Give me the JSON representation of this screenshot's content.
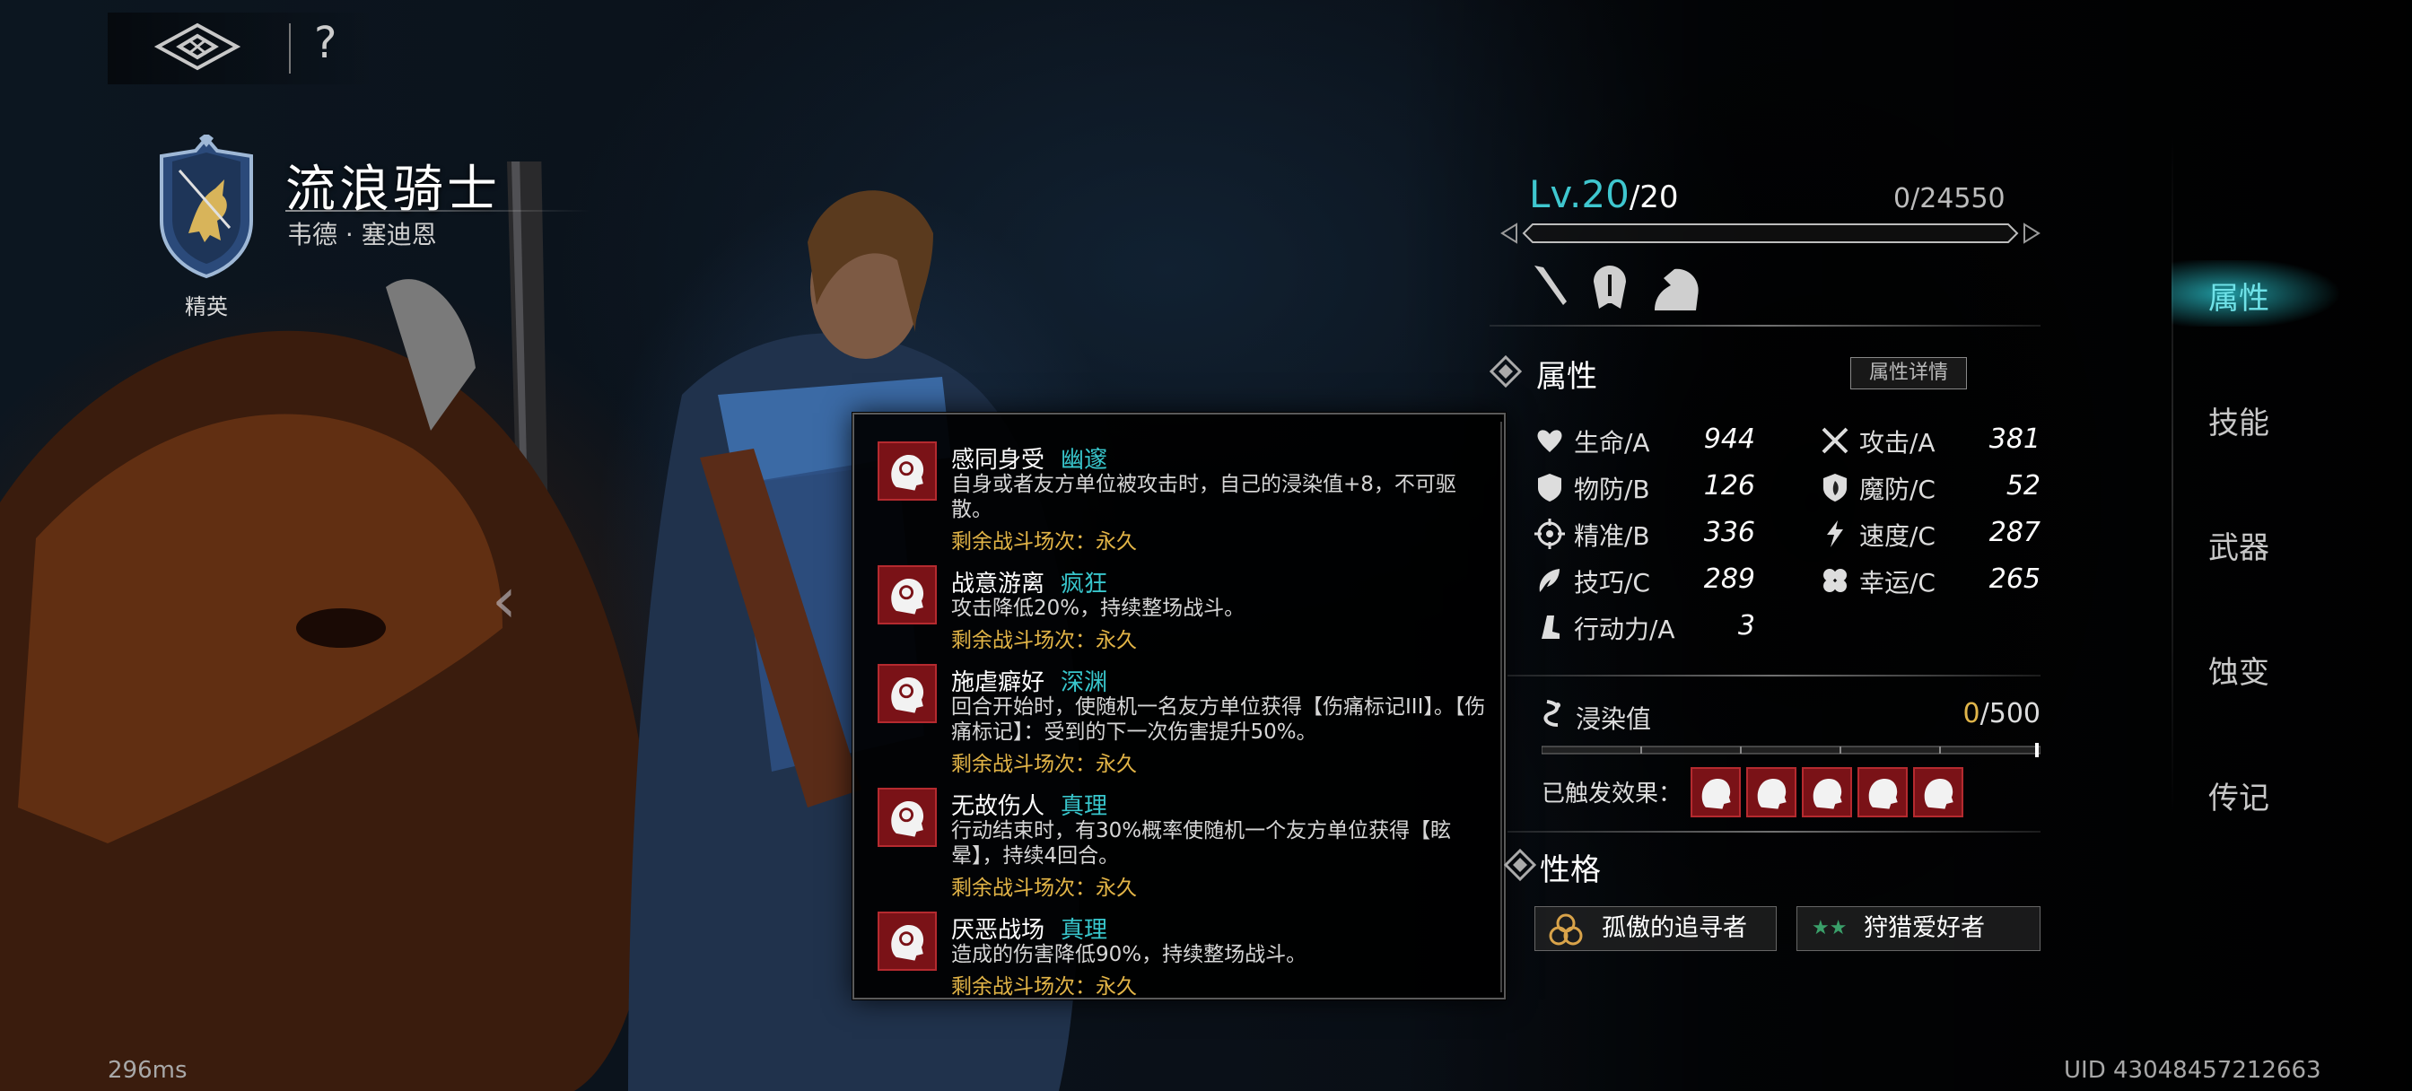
{
  "topbar": {
    "help": "?"
  },
  "hero": {
    "name": "流浪骑士",
    "subtitle": "韦德 · 塞迪恩",
    "rank": "精英"
  },
  "tooltip": {
    "buffs": [
      {
        "name": "感同身受",
        "tag": "幽邃",
        "desc": "自身或者友方单位被攻击时，自己的浸染值+8，不可驱散。",
        "remain": "剩余战斗场次：永久"
      },
      {
        "name": "战意游离",
        "tag": "疯狂",
        "desc": "攻击降低20%，持续整场战斗。",
        "remain": "剩余战斗场次：永久"
      },
      {
        "name": "施虐癖好",
        "tag": "深渊",
        "desc": "回合开始时，使随机一名友方单位获得【伤痛标记III】。【伤痛标记】：受到的下一次伤害提升50%。",
        "remain": "剩余战斗场次：永久"
      },
      {
        "name": "无故伤人",
        "tag": "真理",
        "desc": "行动结束时，有30%概率使随机一个友方单位获得【眩晕】，持续4回合。",
        "remain": "剩余战斗场次：永久"
      },
      {
        "name": "厌恶战场",
        "tag": "真理",
        "desc": "造成的伤害降低90%，持续整场战斗。",
        "remain": "剩余战斗场次：永久"
      }
    ]
  },
  "level": {
    "prefix": "Lv.",
    "current": "20",
    "max": "/20",
    "exp": "0/24550"
  },
  "attributes": {
    "title": "属性",
    "detail_button": "属性详情",
    "stats": [
      {
        "label": "生命/A",
        "value": "944",
        "icon": "heart-icon"
      },
      {
        "label": "攻击/A",
        "value": "381",
        "icon": "crossed-swords-icon"
      },
      {
        "label": "物防/B",
        "value": "126",
        "icon": "shield-icon"
      },
      {
        "label": "魔防/C",
        "value": "52",
        "icon": "magic-shield-icon"
      },
      {
        "label": "精准/B",
        "value": "336",
        "icon": "crosshair-icon"
      },
      {
        "label": "速度/C",
        "value": "287",
        "icon": "speed-icon"
      },
      {
        "label": "技巧/C",
        "value": "289",
        "icon": "skill-icon"
      },
      {
        "label": "幸运/C",
        "value": "265",
        "icon": "clover-icon"
      },
      {
        "label": "行动力/A",
        "value": "3",
        "icon": "boot-icon"
      }
    ],
    "taint_label": "浸染值",
    "taint_current": "0",
    "taint_max": "/500",
    "triggered_label": "已触发效果："
  },
  "personality": {
    "title": "性格",
    "traits": [
      {
        "label": "孤傲的追寻者",
        "stars": ""
      },
      {
        "label": "狩猎爱好者",
        "stars": "★★"
      }
    ]
  },
  "tabs": [
    {
      "label": "属性",
      "active": true
    },
    {
      "label": "技能",
      "active": false
    },
    {
      "label": "武器",
      "active": false
    },
    {
      "label": "蚀变",
      "active": false
    },
    {
      "label": "传记",
      "active": false
    }
  ],
  "footer": {
    "latency": "296ms",
    "uid": "UID 43048457212663"
  },
  "colors": {
    "accent_cyan": "#3fc7cf",
    "gold": "#e3b547",
    "buff_red": "#7a1217"
  }
}
